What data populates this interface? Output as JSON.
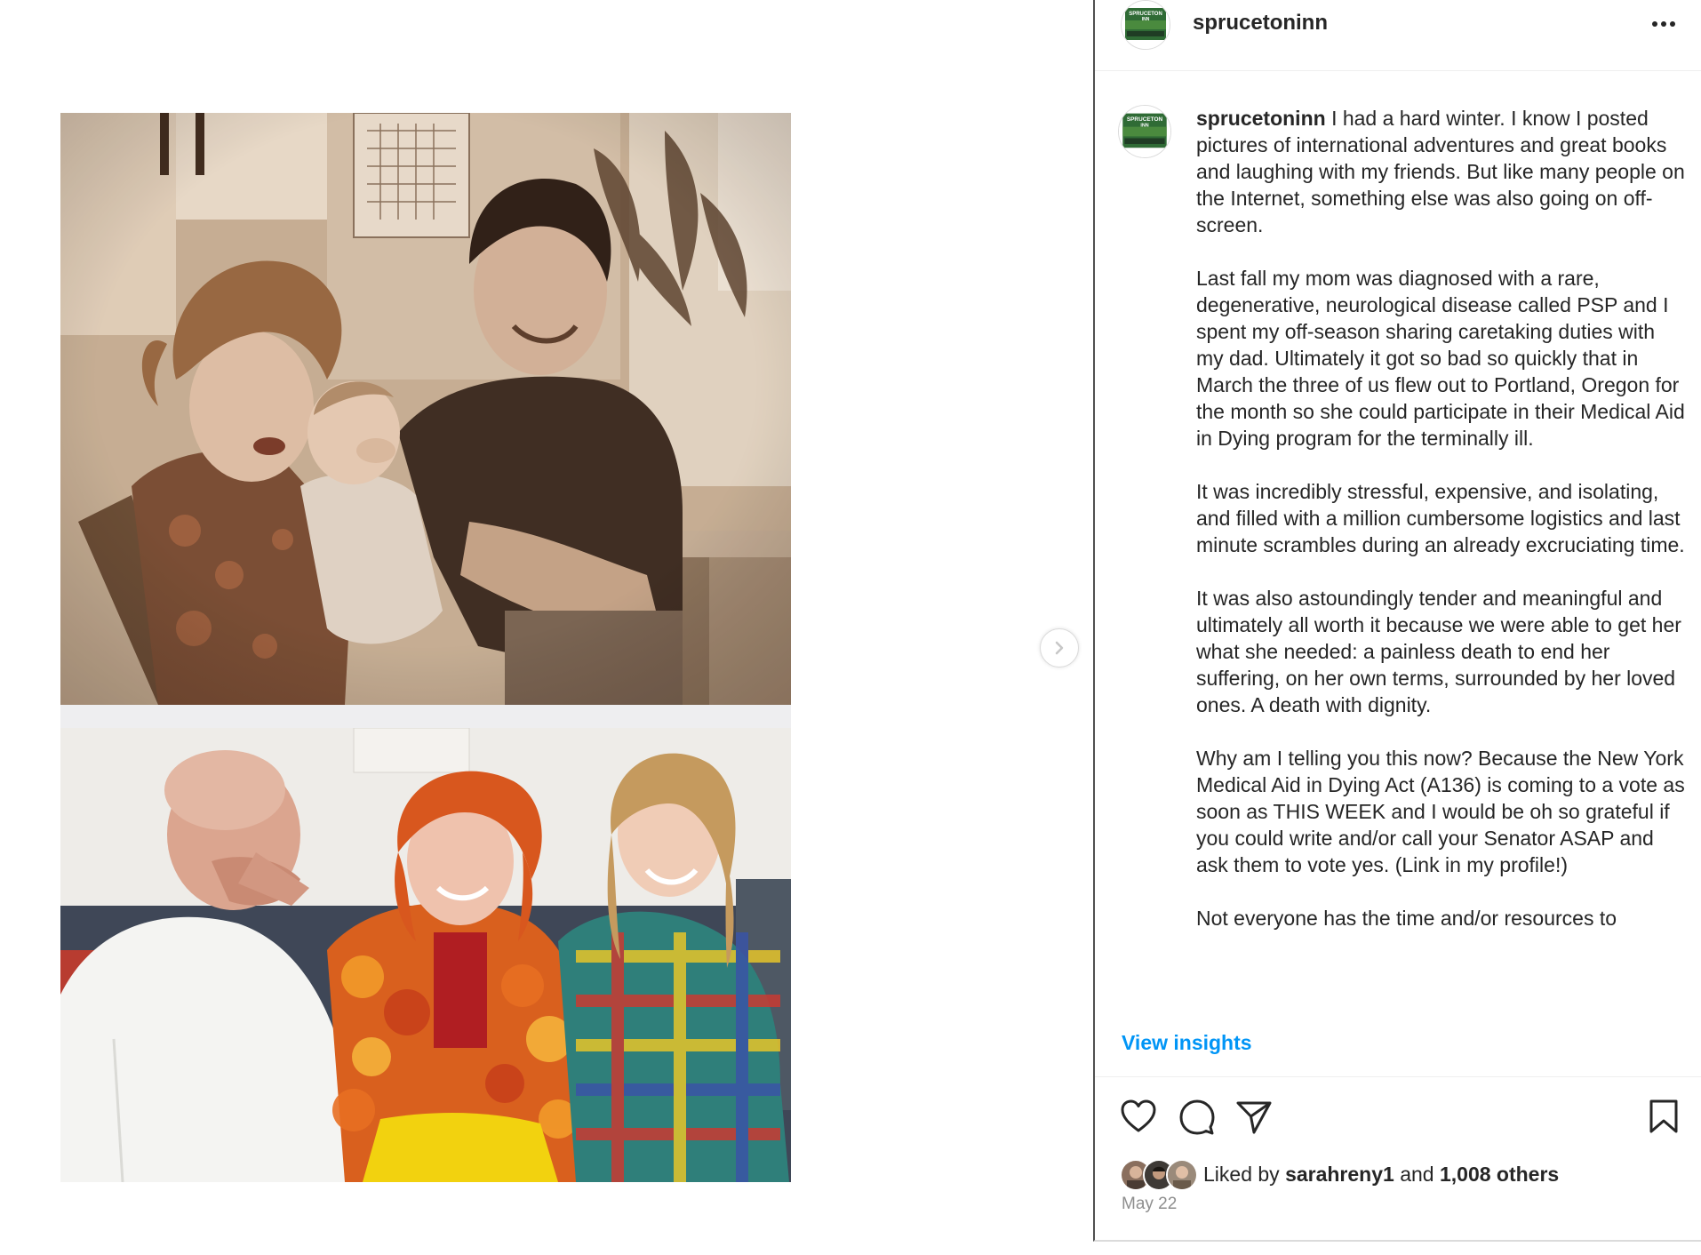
{
  "post": {
    "username": "sprucetoninn",
    "avatar_logo_text": "SPRUCETON INN",
    "avatar_logo_subtext": "RSE AND BAR",
    "more_options_icon": "more-horizontal-icon",
    "next_icon": "chevron-right-icon"
  },
  "caption": {
    "username": "sprucetoninn",
    "paragraphs": [
      "I had a hard winter. I know I posted pictures of international adventures and great books and laughing with my friends. But like many people on the Internet, something else was also going on off-screen.",
      "Last fall my mom was diagnosed with a rare, degenerative, neurological disease called PSP and I spent my off-season sharing caretaking duties with my dad. Ultimately it got so bad so quickly that in March the three of us flew out to Portland, Oregon for the month so she could participate in their Medical Aid in Dying program for the terminally ill.",
      "It was incredibly stressful, expensive, and isolating, and filled with a million cumbersome logistics and last minute scrambles during an already excruciating time.",
      "It was also astoundingly tender and meaningful and ultimately all worth it because we were able to get her what she needed: a painless death to end her suffering, on her own terms, surrounded by her loved ones. A death with dignity.",
      "Why am I telling you this now? Because the New York Medical Aid in Dying Act (A136)  is coming to a vote as soon as THIS WEEK and I would be oh so grateful if you could write and/or call your Senator ASAP and ask them to vote yes. (Link in my profile!)",
      "Not everyone has the time and/or resources to"
    ]
  },
  "insights_label": "View insights",
  "actions": {
    "like_icon": "heart-icon",
    "comment_icon": "comment-icon",
    "share_icon": "paper-plane-icon",
    "save_icon": "bookmark-icon"
  },
  "likes": {
    "prefix": "Liked by ",
    "user": "sarahreny1",
    "middle": " and ",
    "others": "1,008 others"
  },
  "date": "May 22",
  "colors": {
    "link_blue": "#0095f6",
    "text": "#262626",
    "muted": "#8e8e8e",
    "divider": "#efefef"
  }
}
